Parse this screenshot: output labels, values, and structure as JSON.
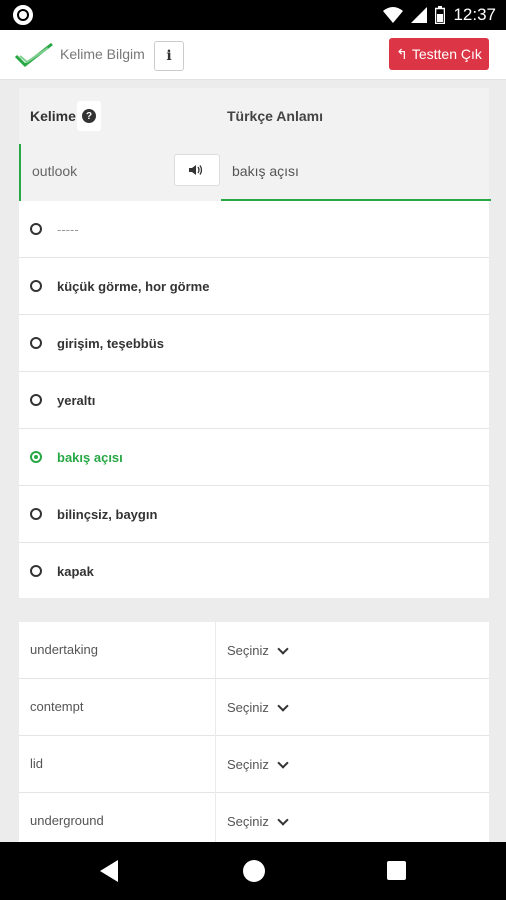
{
  "status_bar": {
    "time": "12:37",
    "icons": [
      "circle-app-icon",
      "wifi-icon",
      "signal-icon",
      "battery-icon"
    ]
  },
  "app_bar": {
    "title": "Kelime Bilgim",
    "info_label": "i",
    "exit_label": "Testten Çık"
  },
  "quiz": {
    "header": {
      "word_label": "Kelime",
      "help_label": "?",
      "meaning_label": "Türkçe Anlamı"
    },
    "current": {
      "word": "outlook",
      "answer": "bakış açısı"
    },
    "options": [
      {
        "label": "-----",
        "selected": false
      },
      {
        "label": "küçük görme, hor görme",
        "selected": false
      },
      {
        "label": "girişim, teşebbüs",
        "selected": false
      },
      {
        "label": "yeraltı",
        "selected": false
      },
      {
        "label": "bakış açısı",
        "selected": true
      },
      {
        "label": "bilinçsiz, baygın",
        "selected": false
      },
      {
        "label": "kapak",
        "selected": false
      }
    ]
  },
  "matching": {
    "rows": [
      {
        "word": "undertaking",
        "select": "Seçiniz"
      },
      {
        "word": "contempt",
        "select": "Seçiniz"
      },
      {
        "word": "lid",
        "select": "Seçiniz"
      },
      {
        "word": "underground",
        "select": "Seçiniz"
      }
    ]
  },
  "colors": {
    "accent": "#28a745",
    "danger": "#dc3545"
  }
}
